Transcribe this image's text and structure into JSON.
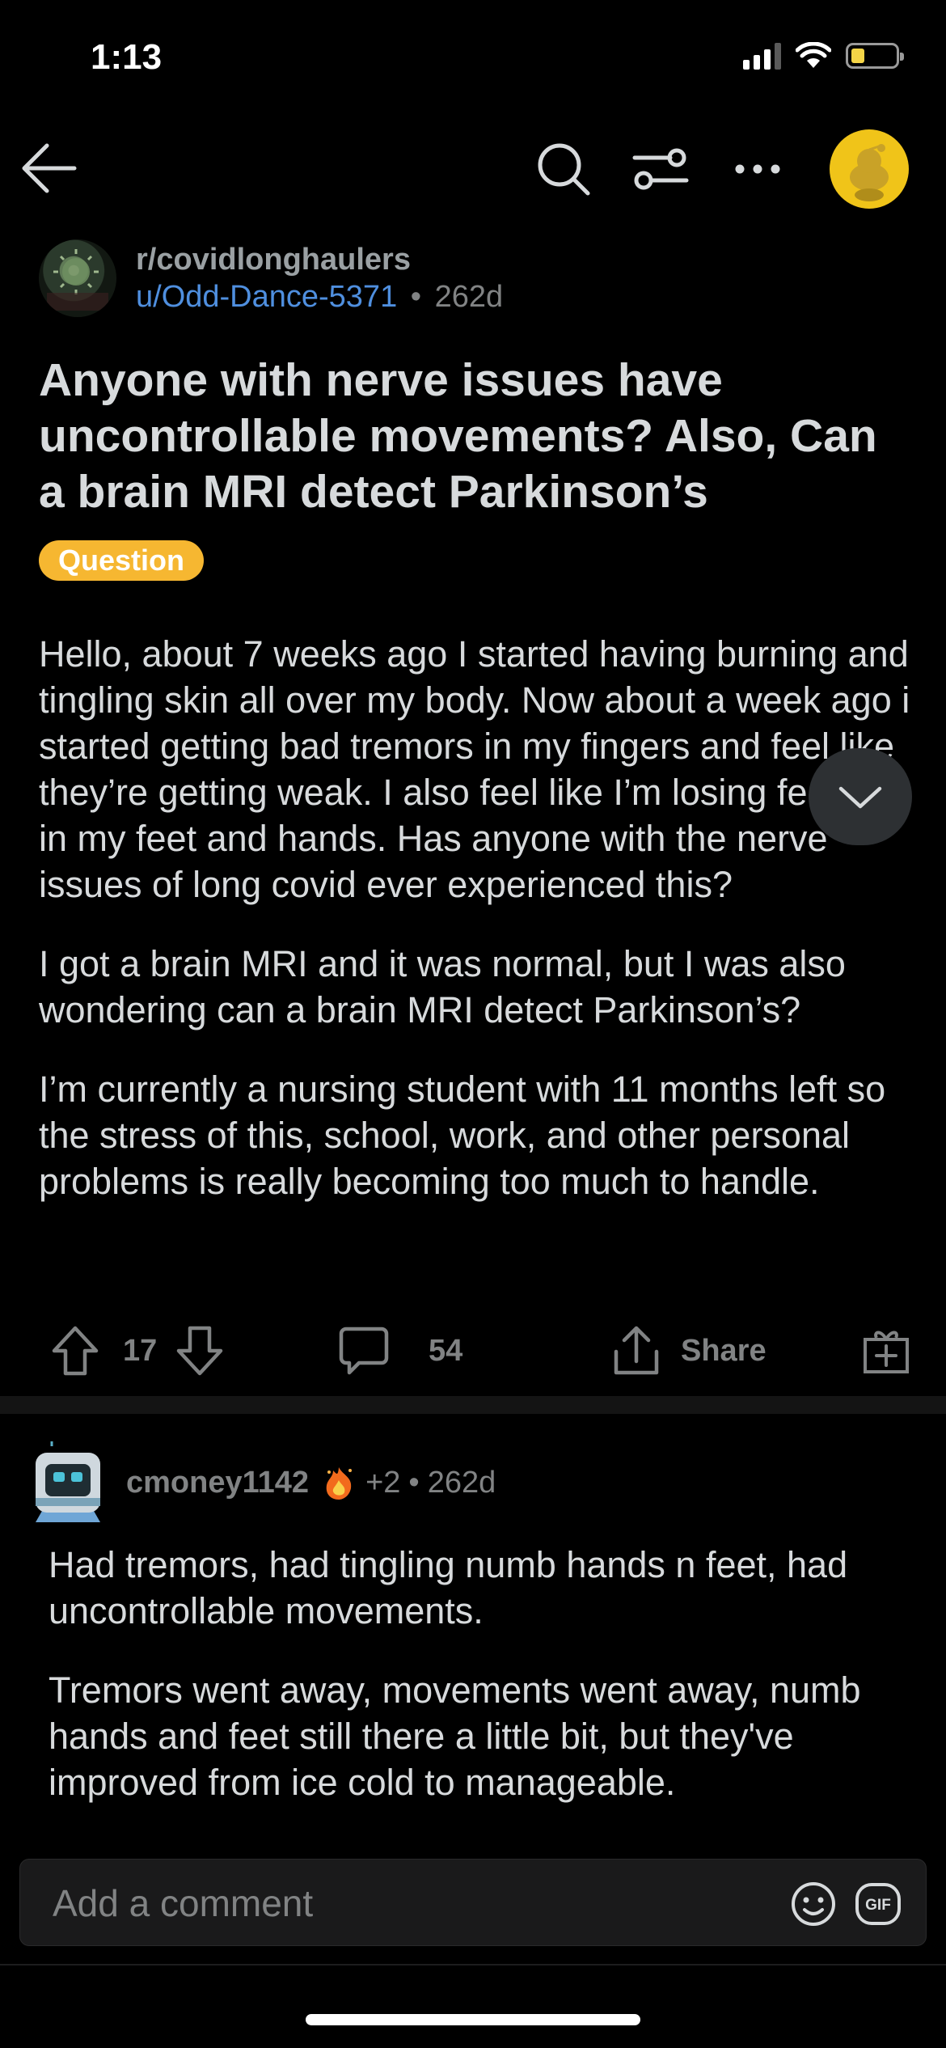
{
  "status_bar": {
    "time": "1:13",
    "battery_color": "#f5d547"
  },
  "nav": {
    "back_icon": "arrow-left-icon",
    "search_icon": "search-icon",
    "sort_icon": "sliders-icon",
    "more_icon": "more-horizontal-icon",
    "avatar_color": "#f0c419"
  },
  "post": {
    "subreddit": "r/covidlonghaulers",
    "author": "u/Odd-Dance-5371",
    "separator": "•",
    "age": "262d",
    "title": "Anyone with nerve issues have uncontrollable movements? Also, Can a brain MRI detect Parkinson’s",
    "flair": "Question",
    "flair_color": "#f6b731",
    "body": [
      "Hello, about 7 weeks ago I started having burning and tingling skin all over my body. Now about a week ago i started getting bad tremors in my fingers and feel like they’re getting weak. I also feel like I’m losing feeling in my feet and hands. Has anyone with the nerve issues of long covid ever experienced this?",
      "I got a brain MRI and it was normal, but I was also wondering can a brain MRI detect Parkinson’s?",
      "I’m currently a nursing student with 11 months left so the stress of this, school, work, and other personal problems is really becoming too much to handle."
    ],
    "votes": "17",
    "comments": "54",
    "share_label": "Share",
    "link_color": "#4f8fdf"
  },
  "comment": {
    "username": "cmoney1142",
    "award_icon": "fire-award-icon",
    "score": "+2",
    "separator": "•",
    "age": "262d",
    "body": [
      "Had tremors, had tingling numb hands n feet, had uncontrollable movements.",
      "Tremors went away,  movements went away, numb hands and feet still there a little bit,  but they've improved from ice cold to manageable."
    ]
  },
  "composer": {
    "placeholder": "Add a comment",
    "gif_label": "GIF"
  }
}
